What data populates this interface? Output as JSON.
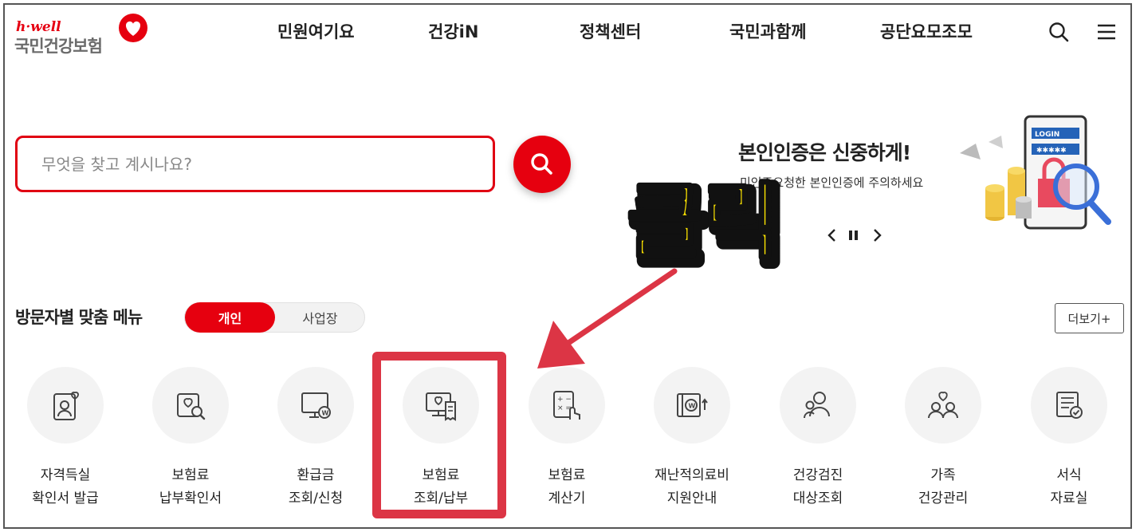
{
  "header": {
    "logo": {
      "tagline": "h·well",
      "name": "국민건강보험"
    },
    "nav": [
      {
        "label": "민원여기요"
      },
      {
        "label": "건강iN"
      },
      {
        "label": "정책센터"
      },
      {
        "label": "국민과함께"
      },
      {
        "label": "공단요모조모"
      }
    ],
    "icons": [
      "search-icon",
      "hamburger-menu-icon"
    ]
  },
  "search": {
    "placeholder": "무엇을 찾고 계시나요?"
  },
  "banner": {
    "title": "본인인증은 신중하게!",
    "subtitle": "미인증요청한 본인인증에 주의하세요",
    "art_label": "LOGIN"
  },
  "annotation": {
    "click_text": "클릭",
    "color": "#dc3545",
    "text_color": "#ffe600"
  },
  "section": {
    "title": "방문자별 맞춤 메뉴",
    "toggle": {
      "active": "개인",
      "inactive": "사업장"
    },
    "more": "더보기+"
  },
  "menu": [
    {
      "line1": "자격득실",
      "line2": "확인서 발급",
      "icon": "id-card-heart-icon"
    },
    {
      "line1": "보험료",
      "line2": "납부확인서",
      "icon": "heart-search-icon"
    },
    {
      "line1": "환급금",
      "line2": "조회/신청",
      "icon": "monitor-won-icon"
    },
    {
      "line1": "보험료",
      "line2": "조회/납부",
      "icon": "computer-receipt-icon"
    },
    {
      "line1": "보험료",
      "line2": "계산기",
      "icon": "calculator-hand-icon"
    },
    {
      "line1": "재난적의료비",
      "line2": "지원안내",
      "icon": "won-support-icon"
    },
    {
      "line1": "건강검진",
      "line2": "대상조회",
      "icon": "people-search-icon"
    },
    {
      "line1": "가족",
      "line2": "건강관리",
      "icon": "family-heart-icon"
    },
    {
      "line1": "서식",
      "line2": "자료실",
      "icon": "document-check-icon"
    }
  ],
  "colors": {
    "brand_red": "#e6000f",
    "highlight": "#dc3545"
  }
}
